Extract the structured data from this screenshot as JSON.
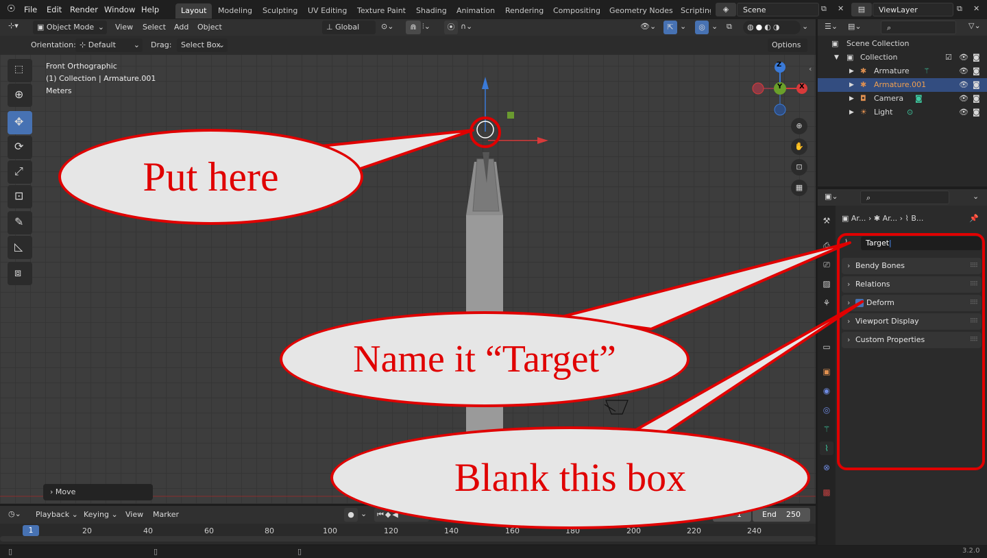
{
  "menu": [
    "File",
    "Edit",
    "Render",
    "Window",
    "Help"
  ],
  "workspaces": [
    "Layout",
    "Modeling",
    "Sculpting",
    "UV Editing",
    "Texture Paint",
    "Shading",
    "Animation",
    "Rendering",
    "Compositing",
    "Geometry Nodes",
    "Scripting"
  ],
  "active_workspace": "Layout",
  "scene": "Scene",
  "view_layer": "ViewLayer",
  "viewport": {
    "mode": "Object Mode",
    "menus": [
      "View",
      "Select",
      "Add",
      "Object"
    ],
    "transform_orientation": "Global",
    "orientation_label": "Orientation:",
    "orientation_value": "Default",
    "drag_label": "Drag:",
    "drag_value": "Select Box",
    "options": "Options",
    "overlay_lines": [
      "Front Orthographic",
      "(1) Collection | Armature.001",
      "Meters"
    ],
    "gizmo_axes": [
      "Z",
      "Y",
      "X"
    ],
    "last_operator": "Move"
  },
  "outliner": {
    "root": "Scene Collection",
    "collection": "Collection",
    "items": [
      "Armature",
      "Armature.001",
      "Camera",
      "Light"
    ],
    "selected": "Armature.001"
  },
  "properties": {
    "breadcrumb": [
      "Ar...",
      "Ar...",
      "B..."
    ],
    "bone_name": "Target",
    "panels": [
      "Bendy Bones",
      "Relations",
      "Deform",
      "Viewport Display",
      "Custom Properties"
    ],
    "deform_checked": true
  },
  "timeline": {
    "menus": [
      "Playback",
      "Keying",
      "View",
      "Marker"
    ],
    "current_frame": "1",
    "start": "1",
    "end_label": "End",
    "end": "250",
    "ticks": [
      "20",
      "40",
      "60",
      "80",
      "100",
      "120",
      "140",
      "160",
      "180",
      "200",
      "220",
      "240"
    ]
  },
  "version": "3.2.0",
  "annotations": {
    "put_here": "Put here",
    "name_it": "Name it “Target”",
    "blank_box": "Blank this box"
  },
  "colors": {
    "accent": "#4772b3",
    "annotation": "#e00000",
    "selected_row": "#334d80"
  }
}
